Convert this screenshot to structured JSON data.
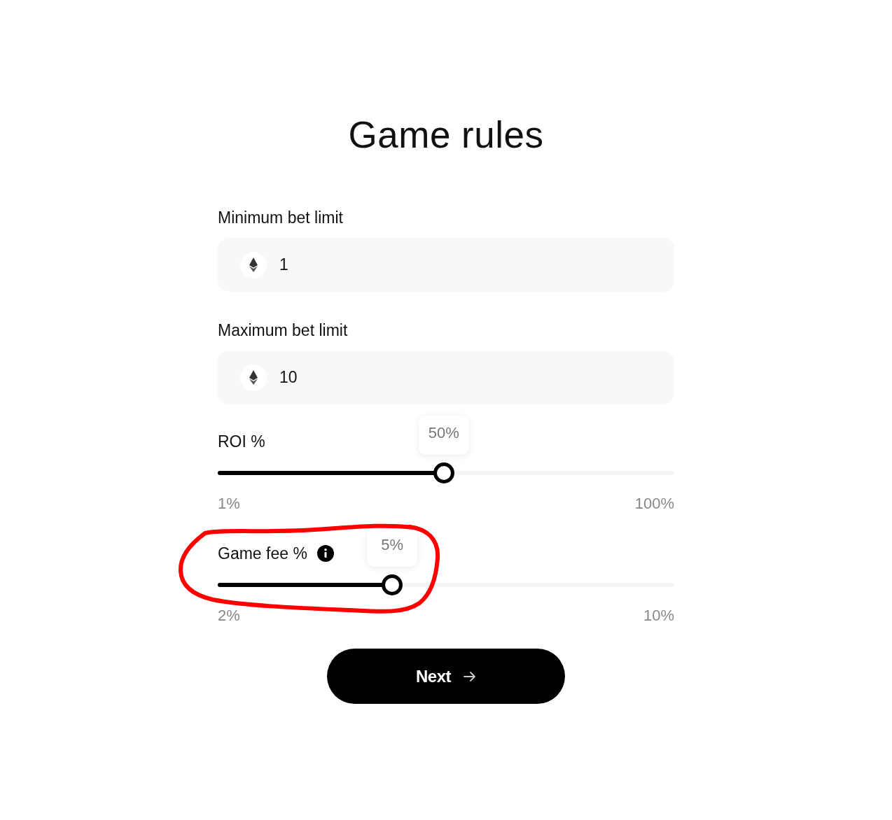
{
  "title": "Game rules",
  "fields": [
    {
      "label": "Minimum bet limit",
      "value": "1"
    },
    {
      "label": "Maximum bet limit",
      "value": "10"
    }
  ],
  "sliders": [
    {
      "label": "ROI %",
      "info": false,
      "level": 0.495,
      "reading": "50%",
      "min_label": "1%",
      "max_label": "100%",
      "circled": false
    },
    {
      "label": "Game fee %",
      "info": true,
      "level": 0.382,
      "reading": "5%",
      "min_label": "2%",
      "max_label": "10%",
      "circled": true
    }
  ],
  "next_button": {
    "label": "Next"
  }
}
